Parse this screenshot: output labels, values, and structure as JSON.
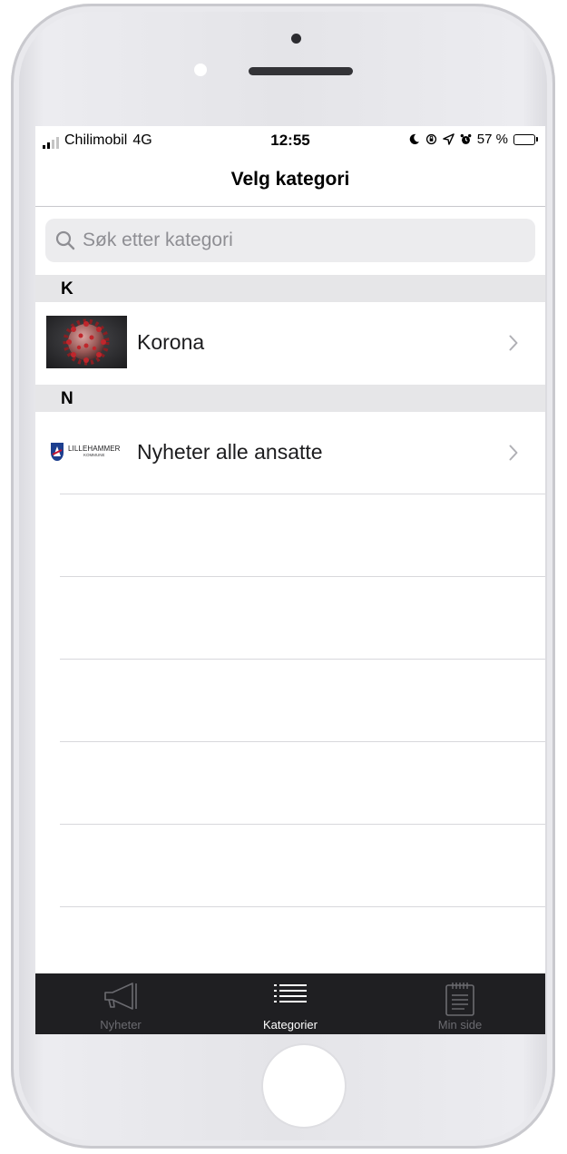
{
  "status_bar": {
    "carrier": "Chilimobil",
    "network": "4G",
    "time": "12:55",
    "battery_percent": "57 %",
    "battery_level": 0.57,
    "icons": [
      "moon-icon",
      "rotation-lock-icon",
      "location-arrow-icon",
      "alarm-icon"
    ]
  },
  "header": {
    "title": "Velg kategori"
  },
  "search": {
    "placeholder": "Søk etter kategori"
  },
  "sections": [
    {
      "letter": "K",
      "items": [
        {
          "label": "Korona",
          "thumbnail": "coronavirus-image"
        }
      ]
    },
    {
      "letter": "N",
      "items": [
        {
          "label": "Nyheter alle ansatte",
          "thumbnail": "lillehammer-kommune-logo",
          "logo_text": "LILLEHAMMER",
          "logo_subtext": "KOMMUNE"
        }
      ]
    }
  ],
  "tab_bar": {
    "tabs": [
      {
        "label": "Nyheter",
        "icon": "megaphone-icon",
        "active": false
      },
      {
        "label": "Kategorier",
        "icon": "list-icon",
        "active": true
      },
      {
        "label": "Min side",
        "icon": "notepad-icon",
        "active": false
      }
    ]
  },
  "colors": {
    "tab_bar_bg": "#1f1f22",
    "section_bg": "#e6e6e8",
    "search_bg": "#ececee",
    "inactive_tab": "#6b6b70",
    "active_tab": "#ffffff"
  }
}
